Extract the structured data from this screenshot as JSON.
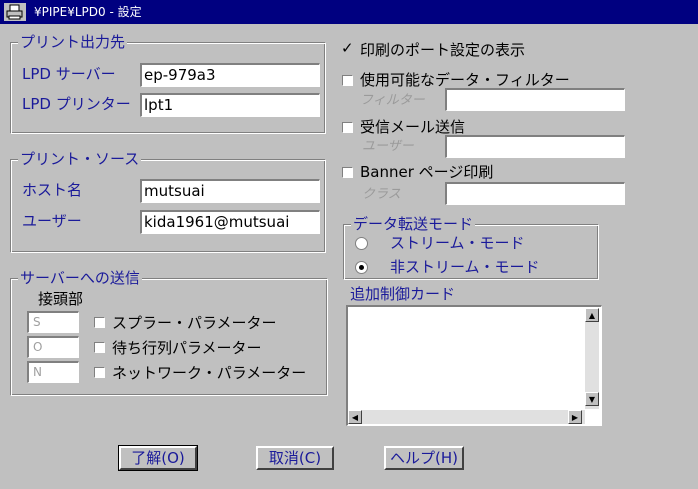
{
  "window": {
    "title": "¥PIPE¥LPD0 - 設定"
  },
  "print_dest": {
    "legend": "プリント出力先",
    "server_label": "LPD サーバー",
    "server_value": "ep-979a3",
    "printer_label": "LPD プリンター",
    "printer_value": "lpt1"
  },
  "print_source": {
    "legend": "プリント・ソース",
    "host_label": "ホスト名",
    "host_value": "mutsuai",
    "user_label": "ユーザー",
    "user_value": "kida1961@mutsuai"
  },
  "send_to_server": {
    "legend": "サーバーへの送信",
    "prefix_label": "接頭部",
    "spooler_prefix": "S",
    "queue_prefix": "O",
    "network_prefix": "N",
    "spooler_label": "スプラー・パラメーター",
    "queue_label": "待ち行列パラメーター",
    "network_label": "ネットワーク・パラメーター"
  },
  "options": {
    "show_port_label": "印刷のポート設定の表示",
    "show_port_checked": true,
    "use_filter_label": "使用可能なデータ・フィルター",
    "filter_label": "フィルター",
    "mail_label": "受信メール送信",
    "mail_user_label": "ユーザー",
    "banner_label": "Banner ページ印刷",
    "class_label": "クラス"
  },
  "transfer_mode": {
    "legend": "データ転送モード",
    "stream_label": "ストリーム・モード",
    "nonstream_label": "非ストリーム・モード",
    "selected": "nonstream"
  },
  "control_card": {
    "label": "追加制御カード",
    "value": ""
  },
  "buttons": {
    "ok": "了解(O)",
    "cancel": "取消(C)",
    "help": "ヘルプ(H)"
  }
}
